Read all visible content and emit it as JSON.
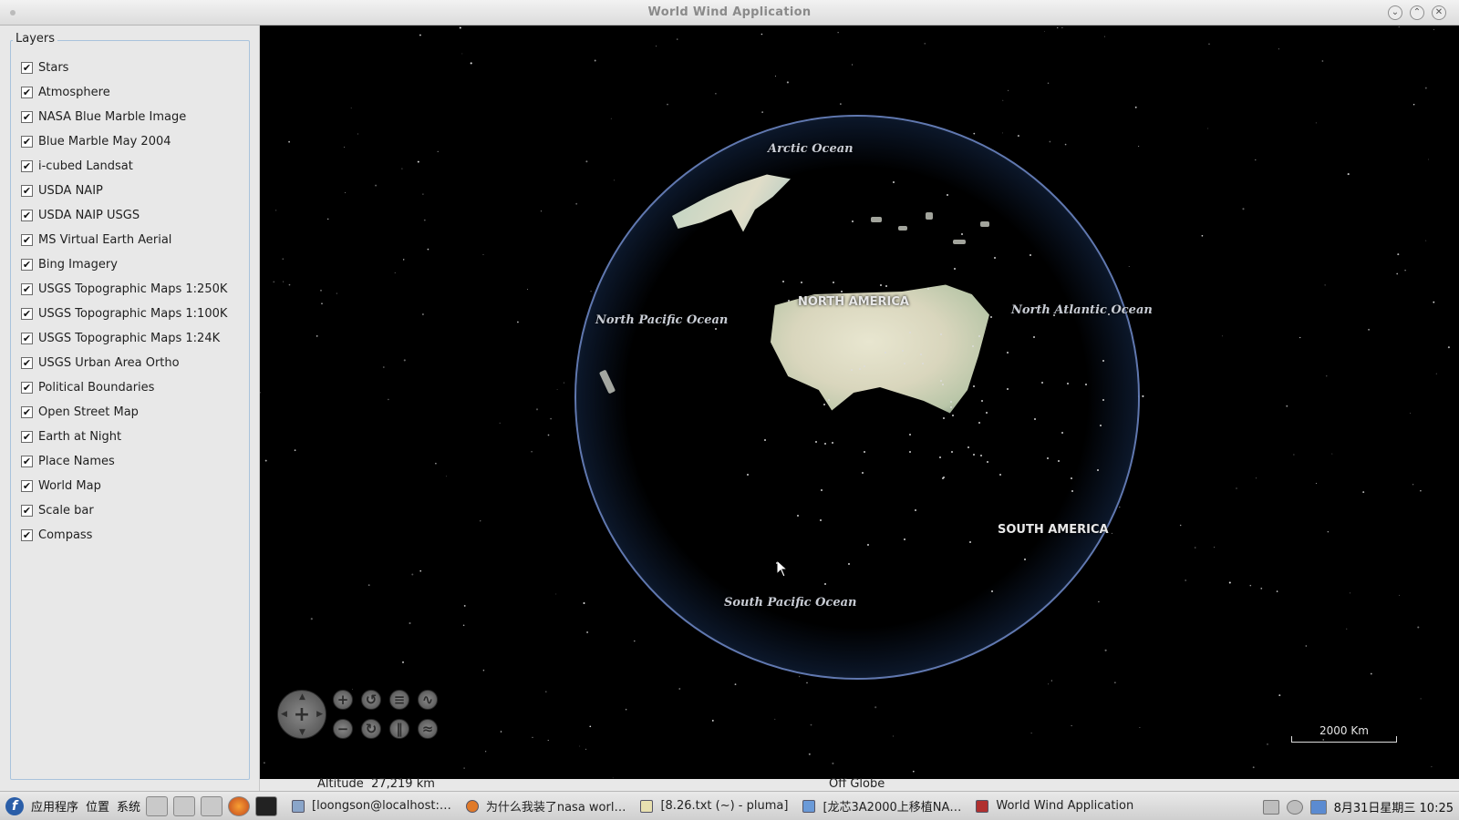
{
  "window": {
    "title": "World Wind Application"
  },
  "layers_panel": {
    "title": "Layers",
    "items": [
      {
        "label": "Stars",
        "checked": true
      },
      {
        "label": "Atmosphere",
        "checked": true
      },
      {
        "label": "NASA Blue Marble Image",
        "checked": true
      },
      {
        "label": "Blue Marble May 2004",
        "checked": true
      },
      {
        "label": "i-cubed Landsat",
        "checked": true
      },
      {
        "label": "USDA NAIP",
        "checked": true
      },
      {
        "label": "USDA NAIP USGS",
        "checked": true
      },
      {
        "label": "MS Virtual Earth Aerial",
        "checked": true
      },
      {
        "label": "Bing Imagery",
        "checked": true
      },
      {
        "label": "USGS Topographic Maps 1:250K",
        "checked": true
      },
      {
        "label": "USGS Topographic Maps 1:100K",
        "checked": true
      },
      {
        "label": "USGS Topographic Maps 1:24K",
        "checked": true
      },
      {
        "label": "USGS Urban Area Ortho",
        "checked": true
      },
      {
        "label": "Political Boundaries",
        "checked": true
      },
      {
        "label": "Open Street Map",
        "checked": true
      },
      {
        "label": "Earth at Night",
        "checked": true
      },
      {
        "label": "Place Names",
        "checked": true
      },
      {
        "label": "World Map",
        "checked": true
      },
      {
        "label": "Scale bar",
        "checked": true
      },
      {
        "label": "Compass",
        "checked": true
      }
    ]
  },
  "globe": {
    "labels": {
      "arctic": "Arctic Ocean",
      "north_america": "NORTH AMERICA",
      "north_pacific": "North Pacific Ocean",
      "north_atlantic": "North Atlantic Ocean",
      "south_america": "SOUTH AMERICA",
      "south_pacific": "South Pacific Ocean"
    },
    "scale_bar": "2000 Km"
  },
  "status": {
    "altitude_label": "Altitude",
    "altitude_value": "27,219 km",
    "position": "Off Globe"
  },
  "taskbar": {
    "menus": [
      "应用程序",
      "位置",
      "系统"
    ],
    "tasks": [
      "[loongson@localhost:…",
      "为什么我装了nasa worl…",
      "[8.26.txt (~) - pluma]",
      "[龙芯3A2000上移植NA…",
      "World Wind Application"
    ],
    "clock": "8月31日星期三 10:25"
  }
}
